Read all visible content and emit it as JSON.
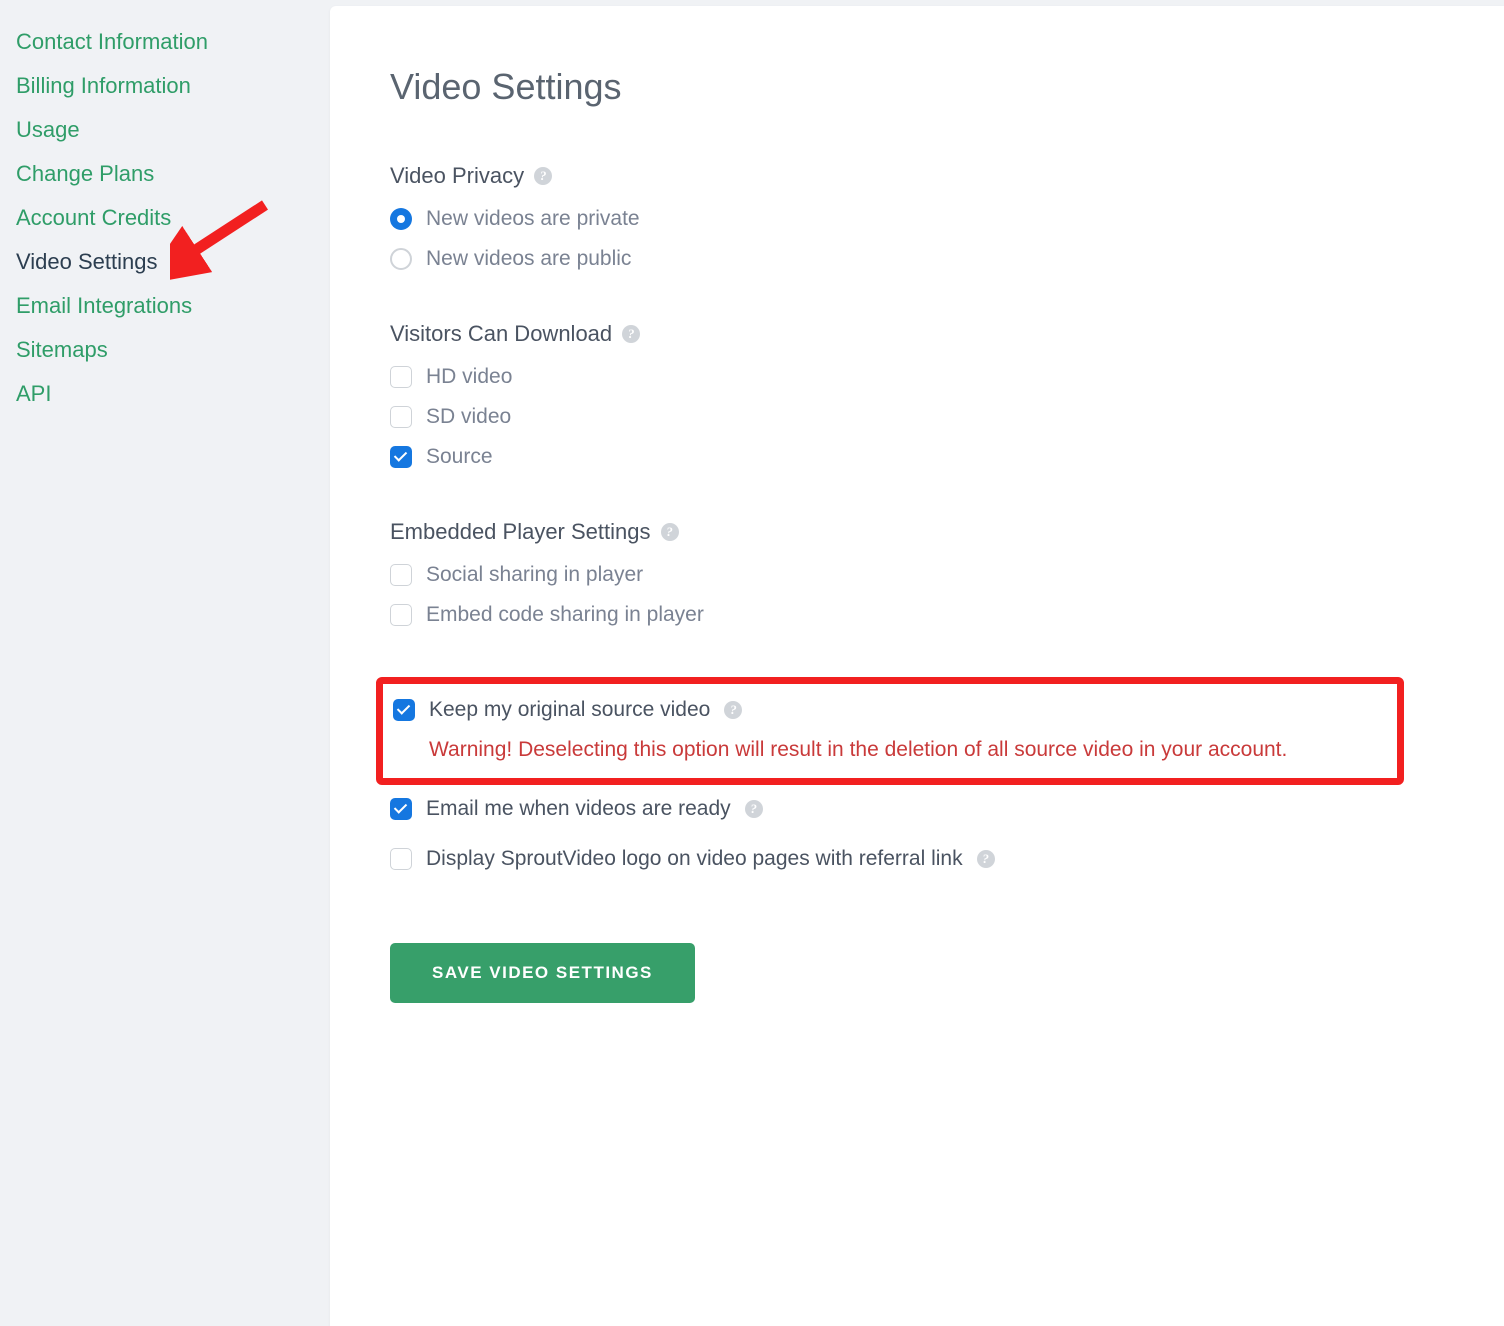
{
  "sidebar": {
    "items": [
      {
        "label": "Contact Information",
        "active": false
      },
      {
        "label": "Billing Information",
        "active": false
      },
      {
        "label": "Usage",
        "active": false
      },
      {
        "label": "Change Plans",
        "active": false
      },
      {
        "label": "Account Credits",
        "active": false
      },
      {
        "label": "Video Settings",
        "active": true
      },
      {
        "label": "Email Integrations",
        "active": false
      },
      {
        "label": "Sitemaps",
        "active": false
      },
      {
        "label": "API",
        "active": false
      }
    ]
  },
  "page": {
    "title": "Video Settings"
  },
  "sections": {
    "privacy": {
      "title": "Video Privacy",
      "options": {
        "private": "New videos are private",
        "public": "New videos are public"
      }
    },
    "download": {
      "title": "Visitors Can Download",
      "options": {
        "hd": "HD video",
        "sd": "SD video",
        "source": "Source"
      }
    },
    "embedded": {
      "title": "Embedded Player Settings",
      "options": {
        "social": "Social sharing in player",
        "embed": "Embed code sharing in player"
      }
    },
    "other": {
      "keep_source": "Keep my original source video",
      "keep_source_warning": "Warning! Deselecting this option will result in the deletion of all source video in your account.",
      "email_ready": "Email me when videos are ready",
      "display_logo": "Display SproutVideo logo on video pages with referral link"
    }
  },
  "button": {
    "save": "SAVE VIDEO SETTINGS"
  }
}
